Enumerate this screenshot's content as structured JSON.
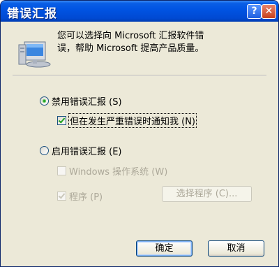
{
  "window": {
    "title": "错误汇报"
  },
  "titlebar_buttons": {
    "help": "?",
    "close": "✕"
  },
  "message": {
    "line1": "您可以选择向 Microsoft 汇报软件错",
    "line2": "误，帮助 Microsoft 提高产品质量。"
  },
  "options": {
    "disable_reporting": {
      "label": "禁用错误汇报 (S)",
      "selected": true
    },
    "notify_critical": {
      "label": "但在发生严重错误时通知我 (N)",
      "checked": true
    },
    "enable_reporting": {
      "label": "启用错误汇报 (E)",
      "selected": false
    },
    "windows_os": {
      "label": "Windows 操作系统 (W)",
      "checked": false,
      "enabled": false
    },
    "programs": {
      "label": "程序 (P)",
      "checked": true,
      "enabled": false
    }
  },
  "buttons": {
    "choose_programs": "选择程序 (C)...",
    "ok": "确定",
    "cancel": "取消"
  },
  "colors": {
    "title_bar": "#0054e3",
    "face": "#ece9d8",
    "radio_dot": "#21a121",
    "disabled_text": "#aca899"
  }
}
